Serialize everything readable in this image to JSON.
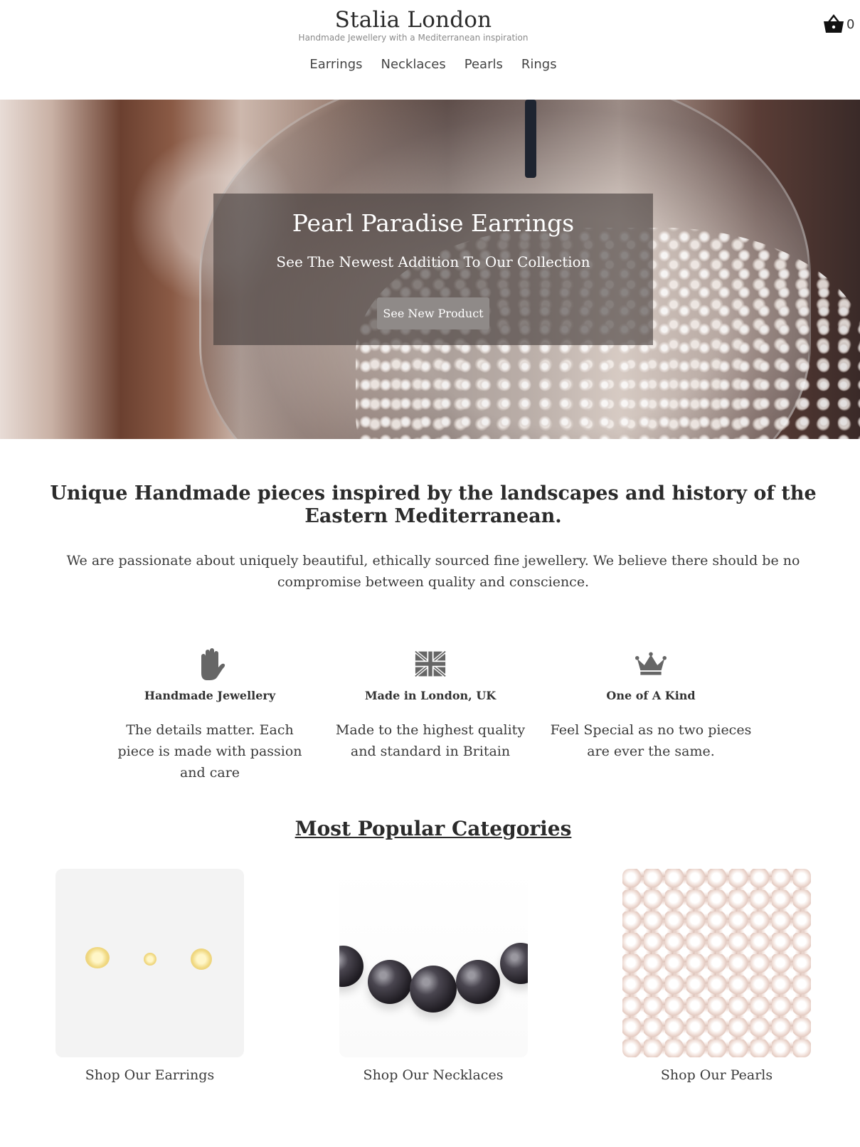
{
  "header": {
    "title": "Stalia London",
    "tagline": "Handmade Jewellery with a Mediterranean inspiration",
    "cart_count": "0"
  },
  "nav": {
    "items": [
      {
        "label": "Earrings"
      },
      {
        "label": "Necklaces"
      },
      {
        "label": "Pearls"
      },
      {
        "label": "Rings"
      }
    ]
  },
  "hero": {
    "title": "Pearl Paradise Earrings",
    "subtitle": "See The Newest Addition To Our Collection",
    "button_label": "See New Product"
  },
  "intro": {
    "heading": "Unique Handmade pieces inspired by the landscapes and history of the Eastern Mediterranean.",
    "text": "We are passionate about uniquely beautiful, ethically sourced fine jewellery. We believe there should be no compromise between quality and conscience."
  },
  "features": [
    {
      "icon": "hand-icon",
      "title": "Handmade Jewellery",
      "text": "The details matter. Each piece is made with passion and care"
    },
    {
      "icon": "union-jack-flag-icon",
      "title": "Made in London, UK",
      "text": "Made to the highest quality and standard in Britain"
    },
    {
      "icon": "crown-icon",
      "title": "One of A Kind",
      "text": "Feel Special as no two pieces are ever the same."
    }
  ],
  "categories": {
    "heading": "Most Popular Categories",
    "items": [
      {
        "label": "Shop Our Earrings"
      },
      {
        "label": "Shop Our Necklaces"
      },
      {
        "label": "Shop Our Pearls"
      }
    ]
  },
  "colors": {
    "text": "#333333",
    "icon_gray": "#666666",
    "hero_overlay": "#463e3c",
    "button": "#8f8a88"
  }
}
